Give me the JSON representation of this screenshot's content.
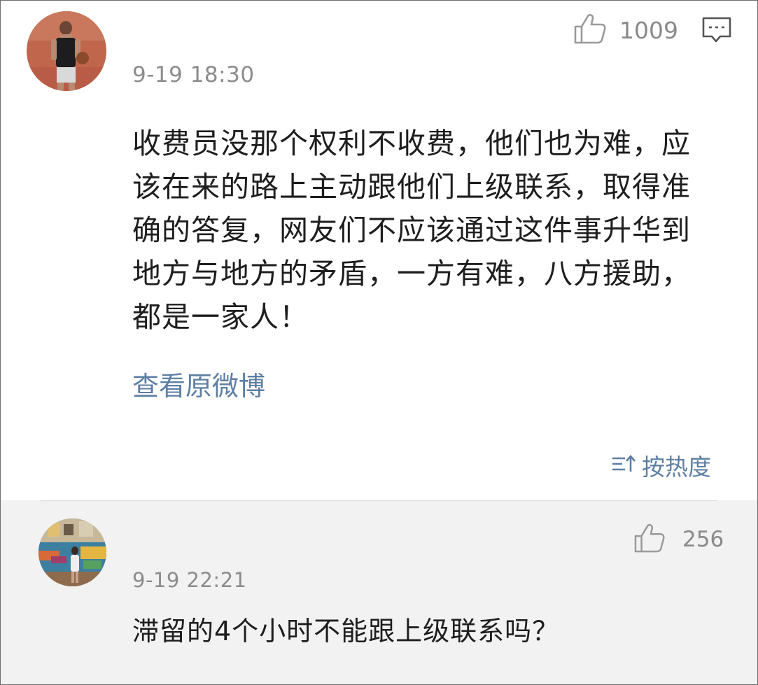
{
  "main_comment": {
    "like_count": "1009",
    "timestamp": "9-19 18:30",
    "text": "收费员没那个权利不收费，他们也为难，应该在来的路上主动跟他们上级联系，取得准确的答复，网友们不应该通过这件事升华到地方与地方的矛盾，一方有难，八方援助，都是一家人！",
    "view_original_label": "查看原微博",
    "icons": {
      "avatar": "user-avatar-basketball-photo",
      "like": "thumbs-up-icon",
      "reply": "comment-bubble-icon"
    }
  },
  "sort": {
    "label": "按热度",
    "icon": "sort-icon"
  },
  "reply": {
    "like_count": "256",
    "timestamp": "9-19 22:21",
    "text": "滞留的4个小时不能跟上级联系吗？",
    "icons": {
      "avatar": "user-avatar-graffiti-wall-photo",
      "like": "thumbs-up-icon"
    }
  },
  "colors": {
    "link_blue": "#5d7fa3",
    "meta_gray": "#8c8c8c",
    "reply_background": "#f2f2f2",
    "text": "#1e1e1e"
  }
}
